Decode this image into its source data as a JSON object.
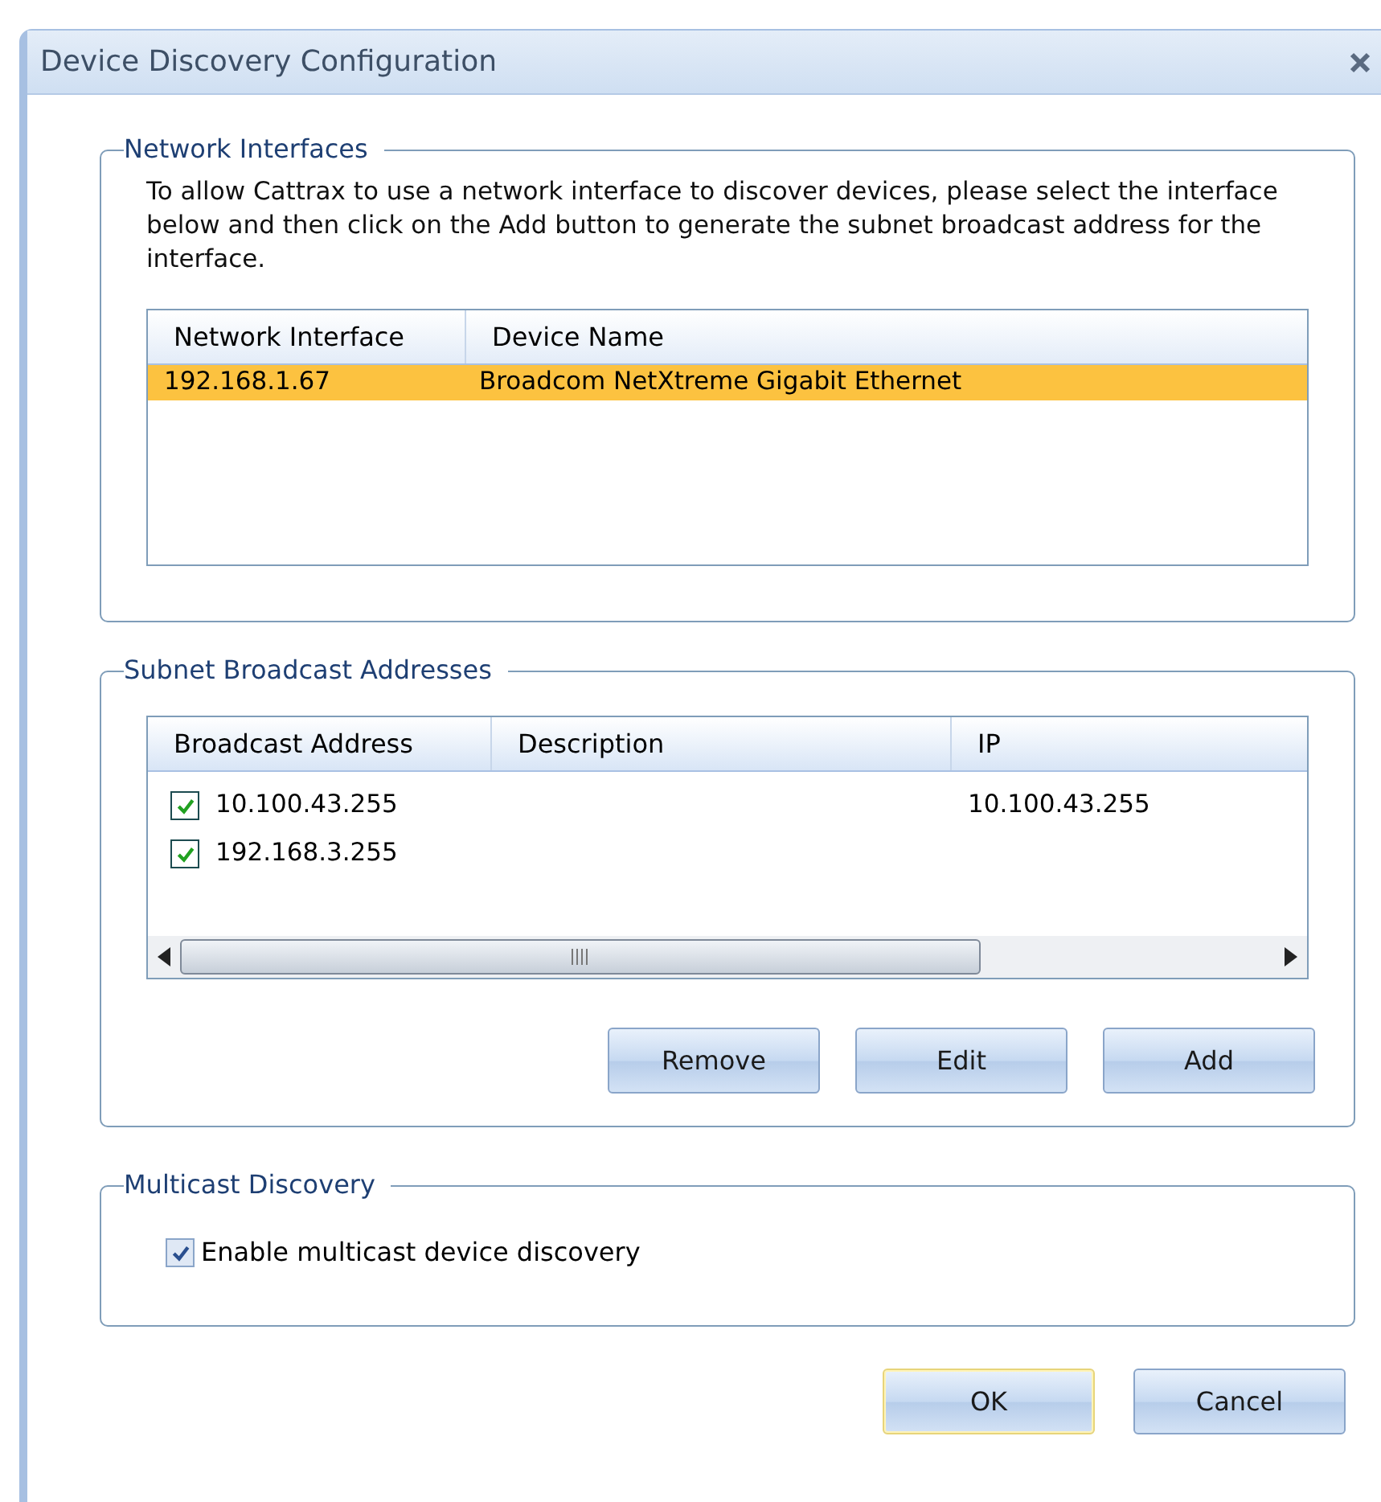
{
  "window": {
    "title": "Device Discovery Configuration"
  },
  "network_interfaces": {
    "title": "Network Interfaces",
    "description": "To allow Cattrax to use a network interface to discover devices, please select the interface below and then click on the Add button to generate the subnet broadcast address for the interface.",
    "columns": [
      "Network Interface",
      "Device Name"
    ],
    "rows": [
      {
        "interface": "192.168.1.67",
        "device_name": "Broadcom NetXtreme Gigabit Ethernet",
        "selected": true
      }
    ]
  },
  "subnet_broadcast": {
    "title": "Subnet Broadcast Addresses",
    "columns": [
      "Broadcast Address",
      "Description",
      "IP"
    ],
    "rows": [
      {
        "address": "10.100.43.255",
        "ip": "10.100.43.255",
        "checked": true
      },
      {
        "address": "192.168.3.255",
        "checked": true
      }
    ],
    "buttons": [
      "Remove",
      "Edit",
      "Add"
    ]
  },
  "multicast": {
    "title": "Multicast Discovery",
    "option": {
      "label": "Enable multicast device discovery",
      "checked": true
    }
  },
  "buttons": [
    {
      "label": "OK",
      "default": true
    },
    {
      "label": "Cancel",
      "default": false
    }
  ]
}
